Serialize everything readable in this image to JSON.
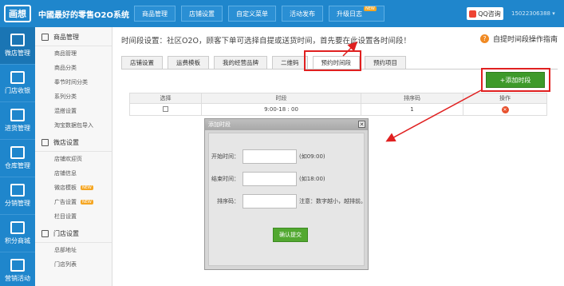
{
  "header": {
    "logo_text": "画想",
    "brand": "中國最好的零售O2O系统",
    "nav": [
      {
        "label": "商品管理"
      },
      {
        "label": "店铺设置"
      },
      {
        "label": "自定义菜单"
      },
      {
        "label": "活动发布"
      },
      {
        "label": "升级日志",
        "badge": "NEW"
      }
    ],
    "qq_label": "QQ咨询",
    "account": "15022306388"
  },
  "rail": [
    {
      "label": "微店管理"
    },
    {
      "label": "门店收银"
    },
    {
      "label": "进货管理"
    },
    {
      "label": "仓库管理"
    },
    {
      "label": "分销管理"
    },
    {
      "label": "积分商城"
    },
    {
      "label": "营销活动"
    }
  ],
  "sidebar": {
    "sections": [
      {
        "title": "商品管理",
        "items": [
          {
            "label": "商品管理"
          },
          {
            "label": "商品分类"
          },
          {
            "label": "奉节时间分类"
          },
          {
            "label": "系列分类"
          },
          {
            "label": "混搭设置"
          },
          {
            "label": "淘宝数据包导入"
          }
        ]
      },
      {
        "title": "微店设置",
        "items": [
          {
            "label": "店铺欢迎页"
          },
          {
            "label": "店铺信息"
          },
          {
            "label": "微店模板",
            "badge": "NEW"
          },
          {
            "label": "广告设置",
            "badge": "NEW"
          },
          {
            "label": "栏目设置"
          }
        ]
      },
      {
        "title": "门店设置",
        "items": [
          {
            "label": "总部地址"
          },
          {
            "label": "门店列表"
          }
        ]
      }
    ]
  },
  "main": {
    "hint": "时间段设置：社区O2O，顾客下单可选择自提或送货时间，首先要在此设置各时间段！",
    "guide": "自提时间段操作指南",
    "tabs": [
      {
        "label": "店铺设置"
      },
      {
        "label": "运费模板"
      },
      {
        "label": "我的经营品牌"
      },
      {
        "label": "二维码"
      },
      {
        "label": "预约时间段",
        "active": true
      },
      {
        "label": "预约项目"
      }
    ],
    "add_button": "+添加时段",
    "table": {
      "headers": [
        "选择",
        "时段",
        "排序码",
        "操作"
      ],
      "rows": [
        {
          "time": "9:00-18 : 00",
          "sort": "1"
        }
      ]
    }
  },
  "modal": {
    "title": "添加时段",
    "close": "✕",
    "fields": [
      {
        "label": "开始时间：",
        "value": "",
        "note": "(如09:00)"
      },
      {
        "label": "结束时间：",
        "value": "",
        "note": "(如18:00)"
      },
      {
        "label": "排序码：",
        "value": "",
        "note": "注意：数字越小，越排前。"
      }
    ],
    "submit": "确认提交"
  },
  "colors": {
    "primary": "#1f86cc",
    "accent_green": "#3e9a2a",
    "highlight_red": "#e02020"
  }
}
